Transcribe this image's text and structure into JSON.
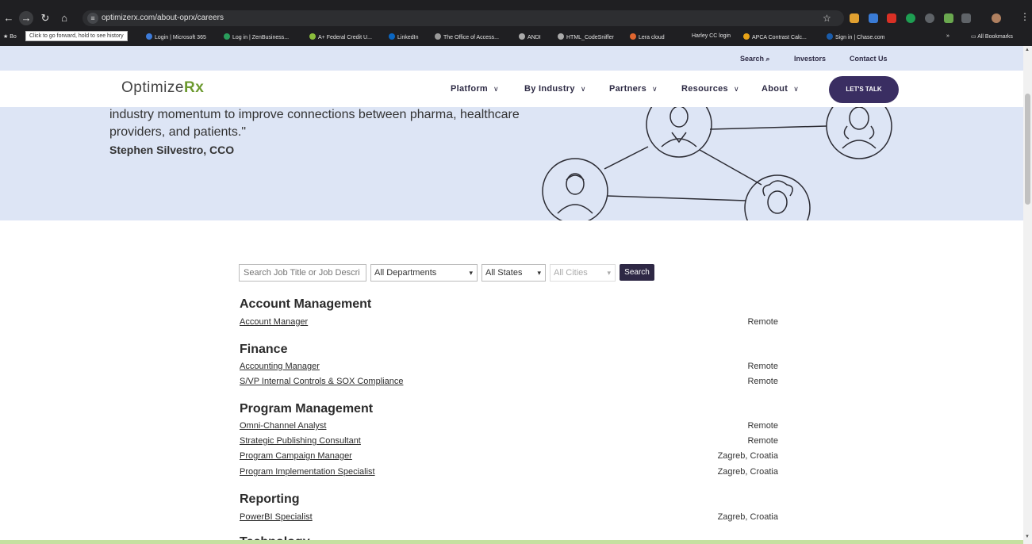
{
  "browser": {
    "url": "optimizerx.com/about-oprx/careers",
    "tooltip": "Click to go forward, hold to see history",
    "bookmarks": [
      {
        "label": "Bo"
      },
      {
        "label": "Login | Microsoft 365",
        "color": "#3d7bd9"
      },
      {
        "label": "Log in | ZenBusiness...",
        "color": "#2a9d5c"
      },
      {
        "label": "A+ Federal Credit U...",
        "color": "#8bbd3c"
      },
      {
        "label": "LinkedIn",
        "color": "#0a66c2"
      },
      {
        "label": "The Office of Access...",
        "color": "#999999"
      },
      {
        "label": "ANDI",
        "color": "#aaaaaa"
      },
      {
        "label": "HTML_CodeSniffer",
        "color": "#aaaaaa"
      },
      {
        "label": "Lera cloud",
        "color": "#e0662f"
      },
      {
        "label": "Harley CC login"
      },
      {
        "label": "APCA Contrast Calc...",
        "color": "#e8a317"
      },
      {
        "label": "Sign in | Chase.com",
        "color": "#1a5cab"
      }
    ],
    "all_bookmarks": "All Bookmarks",
    "more": "»"
  },
  "utility": {
    "search": "Search",
    "investors": "Investors",
    "contact": "Contact Us"
  },
  "nav": {
    "logo_text": "Optimize",
    "logo_rx": "Rx",
    "items": [
      {
        "label": "Platform"
      },
      {
        "label": "By Industry"
      },
      {
        "label": "Partners"
      },
      {
        "label": "Resources"
      },
      {
        "label": "About"
      }
    ],
    "cta": "LET'S TALK"
  },
  "hero": {
    "quote": "industry momentum to improve connections between pharma, healthcare providers, and patients.\"",
    "author": "Stephen Silvestro, CCO"
  },
  "filters": {
    "search_placeholder": "Search Job Title or Job Descri",
    "department": "All Departments",
    "state": "All States",
    "city": "All Cities",
    "button": "Search"
  },
  "departments": [
    {
      "name": "Account Management",
      "jobs": [
        {
          "title": "Account Manager",
          "location": "Remote"
        }
      ]
    },
    {
      "name": "Finance",
      "jobs": [
        {
          "title": "Accounting Manager",
          "location": "Remote"
        },
        {
          "title": "S/VP Internal Controls & SOX Compliance",
          "location": "Remote"
        }
      ]
    },
    {
      "name": "Program Management",
      "jobs": [
        {
          "title": "Omni-Channel Analyst",
          "location": "Remote"
        },
        {
          "title": "Strategic Publishing Consultant",
          "location": "Remote"
        },
        {
          "title": "Program Campaign Manager",
          "location": "Zagreb, Croatia"
        },
        {
          "title": "Program Implementation Specialist",
          "location": "Zagreb, Croatia"
        }
      ]
    },
    {
      "name": "Reporting",
      "jobs": [
        {
          "title": "PowerBI Specialist",
          "location": "Zagreb, Croatia"
        }
      ]
    },
    {
      "name": "Technology",
      "jobs": []
    }
  ],
  "colors": {
    "brand_purple": "#3a2e62",
    "brand_green": "#6c9a2f",
    "hero_bg": "#dde5f5"
  }
}
